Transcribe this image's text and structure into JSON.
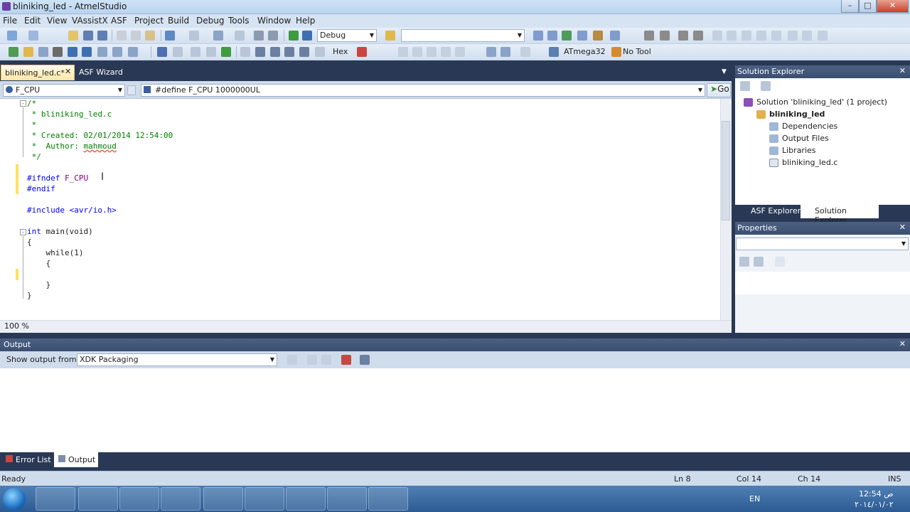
{
  "window": {
    "title": "bliniking_led - AtmelStudio"
  },
  "menu": [
    "File",
    "Edit",
    "View",
    "VAssistX",
    "ASF",
    "Project",
    "Build",
    "Debug",
    "Tools",
    "Window",
    "Help"
  ],
  "toolbar": {
    "config_combo": "Debug",
    "device_label": "ATmega32",
    "tool_label": "No Tool",
    "hex_label": "Hex"
  },
  "editor": {
    "tab_active": "bliniking_led.c*",
    "tab_other": "ASF Wizard",
    "nav_left": "F_CPU",
    "nav_right": "#define F_CPU 1000000UL",
    "go_label": "Go",
    "zoom": "100 %",
    "lines": {
      "l1": "/*",
      "l2": " * bliniking_led.c",
      "l3": " *",
      "l4": " * Created: 02/01/2014 12:54:00",
      "l5_a": " *  Author: ",
      "l5_b": "mahmoud",
      "l6": " */",
      "l7_a": "#ifndef ",
      "l7_b": "F_CPU",
      "l8": "#endif",
      "l9": "#include <avr/io.h>",
      "l10_a": "int ",
      "l10_b": "main(void)",
      "l11": "{",
      "l12": "    while(1)",
      "l13": "    {",
      "l14": "    }",
      "l15": "}"
    }
  },
  "solution_explorer": {
    "title": "Solution Explorer",
    "items": [
      "Solution 'bliniking_led' (1 project)",
      "bliniking_led",
      "Dependencies",
      "Output Files",
      "Libraries",
      "bliniking_led.c"
    ],
    "tab_asf": "ASF Explorer",
    "tab_se": "Solution Explorer"
  },
  "properties": {
    "title": "Properties"
  },
  "output": {
    "title": "Output",
    "show_from_label": "Show output from:",
    "source": "XDK Packaging"
  },
  "bottom_tabs": {
    "errors": "Error List",
    "output": "Output"
  },
  "status": {
    "ready": "Ready",
    "ln": "Ln 8",
    "col": "Col 14",
    "ch": "Ch 14",
    "ins": "INS"
  },
  "taskbar": {
    "lang": "EN",
    "time": "12:54 ص",
    "date": "٢٠١٤/٠١/٠٢"
  },
  "colors": {
    "accent": "#293955",
    "tab_active": "#fde6a4"
  }
}
